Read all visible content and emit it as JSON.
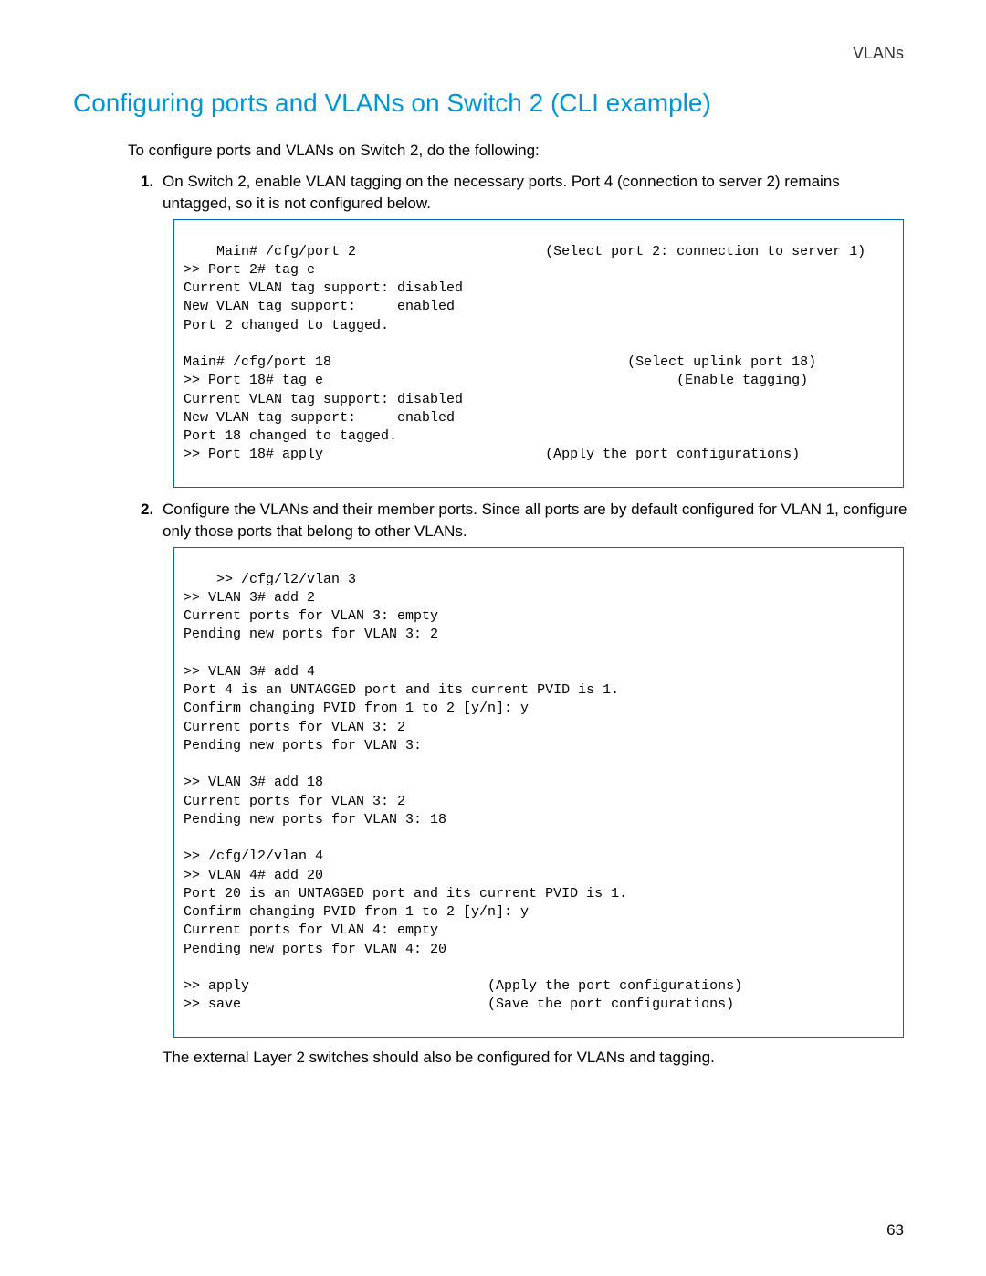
{
  "header": {
    "section": "VLANs"
  },
  "title": "Configuring ports and VLANs on Switch 2 (CLI example)",
  "intro": "To configure ports and VLANs on Switch 2, do the following:",
  "steps": [
    {
      "num": "1.",
      "text": "On Switch 2, enable VLAN tagging on the necessary ports. Port 4 (connection to server 2) remains untagged, so it is not configured below."
    },
    {
      "num": "2.",
      "text": "Configure the VLANs and their member ports. Since all ports are by default configured for VLAN 1, configure only those ports that belong to other VLANs."
    }
  ],
  "code1": "Main# /cfg/port 2                       (Select port 2: connection to server 1)\n>> Port 2# tag e\nCurrent VLAN tag support: disabled\nNew VLAN tag support:     enabled\nPort 2 changed to tagged.\n\nMain# /cfg/port 18                                    (Select uplink port 18)\n>> Port 18# tag e                                           (Enable tagging)\nCurrent VLAN tag support: disabled\nNew VLAN tag support:     enabled\nPort 18 changed to tagged.\n>> Port 18# apply                           (Apply the port configurations)",
  "code2": ">> /cfg/l2/vlan 3\n>> VLAN 3# add 2\nCurrent ports for VLAN 3: empty\nPending new ports for VLAN 3: 2\n\n>> VLAN 3# add 4\nPort 4 is an UNTAGGED port and its current PVID is 1.\nConfirm changing PVID from 1 to 2 [y/n]: y\nCurrent ports for VLAN 3: 2\nPending new ports for VLAN 3:\n\n>> VLAN 3# add 18\nCurrent ports for VLAN 3: 2\nPending new ports for VLAN 3: 18\n\n>> /cfg/l2/vlan 4\n>> VLAN 4# add 20\nPort 20 is an UNTAGGED port and its current PVID is 1.\nConfirm changing PVID from 1 to 2 [y/n]: y\nCurrent ports for VLAN 4: empty\nPending new ports for VLAN 4: 20\n\n>> apply                             (Apply the port configurations)\n>> save                              (Save the port configurations)",
  "closing": "The external Layer 2 switches should also be configured for VLANs and tagging.",
  "pageNumber": "63"
}
